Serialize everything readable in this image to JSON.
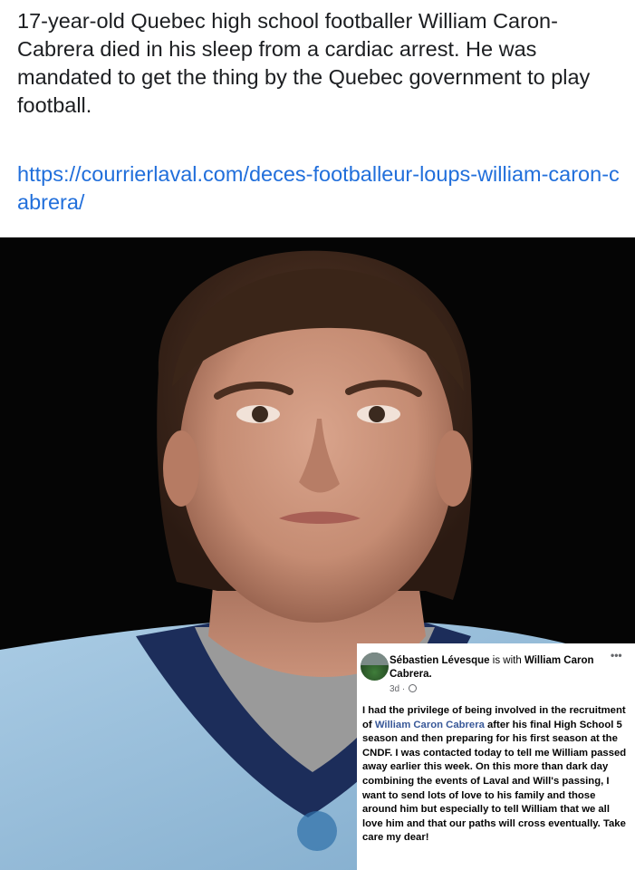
{
  "post": {
    "text": "17-year-old Quebec high school footballer William Caron-Cabrera died in his sleep from a cardiac arrest. He was mandated to get the thing by the Quebec government to play football.",
    "link": "https://courrierlaval.com/deces-footballeur-loups-william-caron-cabrera/"
  },
  "photo": {
    "subject": "Portrait photo of a young man in a light blue football jersey",
    "icon": "person-portrait"
  },
  "facebook_post": {
    "author": "Sébastien Lévesque",
    "with_text": "is with",
    "tagged": "William Caron Cabrera.",
    "time": "3d",
    "privacy_icon": "globe-icon",
    "more_icon": "•••",
    "body_part1": "I had the privilege of being involved in the recruitment of ",
    "body_mention": "William Caron Cabrera",
    "body_part2": " after his final High School 5 season and then preparing for his first season at the CNDF. I was contacted today to tell me William passed away earlier this week. On this more than dark day combining the events of Laval and Will's passing, I want to send lots of love to his family and those around him but especially to tell William that we all love him and that our paths will cross eventually. Take care my dear!"
  },
  "colors": {
    "text": "#1c1e21",
    "link": "#216fdb",
    "mention": "#385898",
    "jersey": "#8fb8d6",
    "background_photo": "#050505"
  }
}
